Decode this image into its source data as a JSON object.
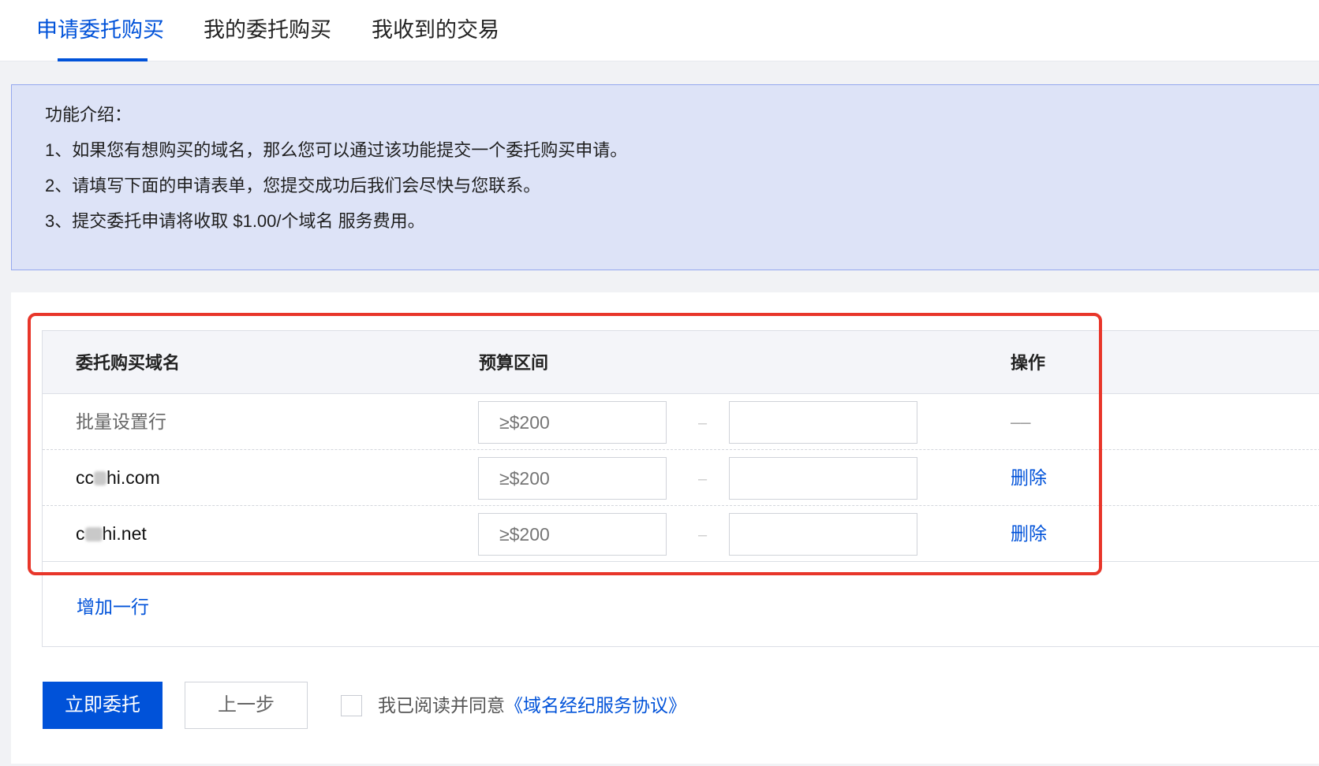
{
  "tabs": [
    {
      "label": "申请委托购买",
      "active": true
    },
    {
      "label": "我的委托购买",
      "active": false
    },
    {
      "label": "我收到的交易",
      "active": false
    }
  ],
  "intro": {
    "title": "功能介绍：",
    "lines": [
      "1、如果您有想购买的域名，那么您可以通过该功能提交一个委托购买申请。",
      "2、请填写下面的申请表单，您提交成功后我们会尽快与您联系。",
      "3、提交委托申请将收取 $1.00/个域名 服务费用。"
    ]
  },
  "table": {
    "headers": {
      "domain": "委托购买域名",
      "budget": "预算区间",
      "action": "操作"
    },
    "rows": [
      {
        "name": "批量设置行",
        "min_placeholder": "≥$200",
        "max_value": "",
        "separator": "–",
        "action": "––"
      },
      {
        "name_prefix": "cc",
        "name_suffix": "hi.com",
        "min_placeholder": "≥$200",
        "max_value": "",
        "separator": "–",
        "action": "删除"
      },
      {
        "name_prefix": "c",
        "name_suffix": "hi.net",
        "min_placeholder": "≥$200",
        "max_value": "",
        "separator": "–",
        "action": "删除"
      }
    ],
    "add_row_label": "增加一行"
  },
  "footer": {
    "submit_label": "立即委托",
    "back_label": "上一步",
    "agree_text": "我已阅读并同意",
    "agree_link": "《域名经纪服务协议》",
    "agree_checked": false
  },
  "colors": {
    "accent": "#0052d9",
    "highlight_border": "#e8362a",
    "intro_bg": "#dde3f7"
  }
}
